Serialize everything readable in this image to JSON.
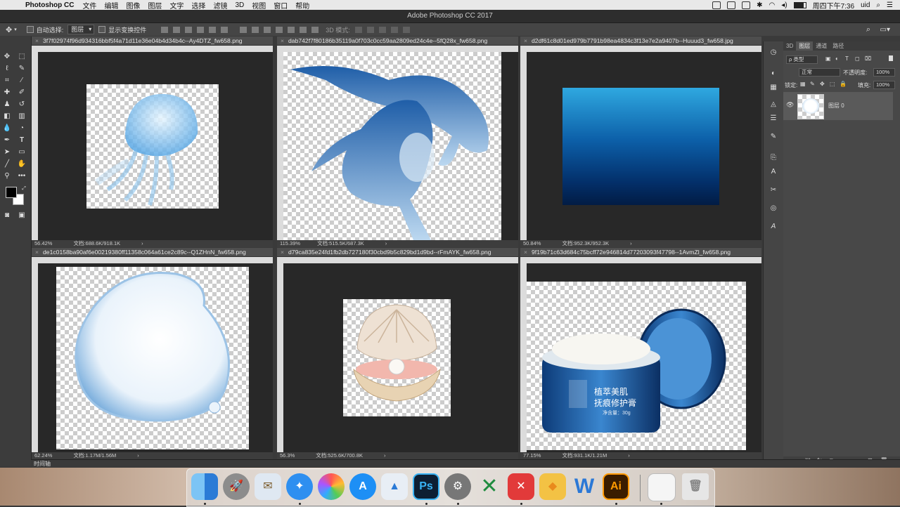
{
  "menubar": {
    "apple": "",
    "app_name": "Photoshop CC",
    "items": [
      "文件",
      "编辑",
      "图像",
      "图层",
      "文字",
      "选择",
      "滤镜",
      "3D",
      "视图",
      "窗口",
      "帮助"
    ],
    "clock": "周四下午7:36",
    "user": "uid"
  },
  "window": {
    "title": "Adobe Photoshop CC 2017"
  },
  "options": {
    "auto_select_label": "自动选择:",
    "auto_select_value": "图层",
    "show_transform_label": "显示变换控件",
    "mode_3d_label": "3D 模式:"
  },
  "documents": [
    {
      "tab": "3f7f02974f96d934316bbf5f4a71d11e36e04b4d34b4c--Ay4DTZ_fw658.png",
      "zoom": "56.42%",
      "doc_size": "文档:688.6K/918.1K"
    },
    {
      "tab": "dab742f7f80186b35119a0f703c0cc59aa2809ed24c4e--5fQ28x_fw658.png",
      "zoom": "115.39%",
      "doc_size": "文档:515.5K/687.3K"
    },
    {
      "tab": "d2df61c8d01ed979b7791b98ea4834c3f13e7e2a9407b--Huuud3_fw658.jpg",
      "zoom": "50.84%",
      "doc_size": "文档:952.3K/952.3K"
    },
    {
      "tab": "de1c0158ba90af6e00219380ff11358c064a61ce2c89c--Q1ZHnN_fw658.png",
      "zoom": "62.24%",
      "doc_size": "文档:1.17M/1.56M"
    },
    {
      "tab": "d79ca835e24fd1fb2db727180f30cbd9b5c829bd1d9bd--rFmAYK_fw658.png",
      "zoom": "56.3%",
      "doc_size": "文档:525.6K/700.8K"
    },
    {
      "tab": "9f19b71c63d684c75bcff72e946814d77203093f47798--1AvmZl_fw658.png",
      "zoom": "77.15%",
      "doc_size": "文档:931.1K/1.21M"
    }
  ],
  "cream": {
    "line1": "植萃美肌",
    "line2": "抚痕修护膏",
    "net": "净含量：30g"
  },
  "layers_panel": {
    "tabs": [
      "3D",
      "图层",
      "通道",
      "路径"
    ],
    "filter_label": "ρ 类型",
    "blend_mode": "正常",
    "opacity_label": "不透明度:",
    "opacity_value": "100%",
    "lock_label": "锁定:",
    "fill_label": "填充:",
    "fill_value": "100%",
    "layer_name": "图层 0"
  },
  "timeline": {
    "label": "时间轴"
  },
  "dock_apps": [
    "Finder",
    "Launchpad",
    "Mail",
    "Safari",
    "Photos",
    "App Store",
    "Keynote",
    "Ps",
    "System Preferences",
    "Excel",
    "XMind",
    "Sketch",
    "Word",
    "Ai",
    "Preview",
    "Trash"
  ],
  "ps_label": "Ps",
  "ai_label": "Ai",
  "word_label": "W"
}
